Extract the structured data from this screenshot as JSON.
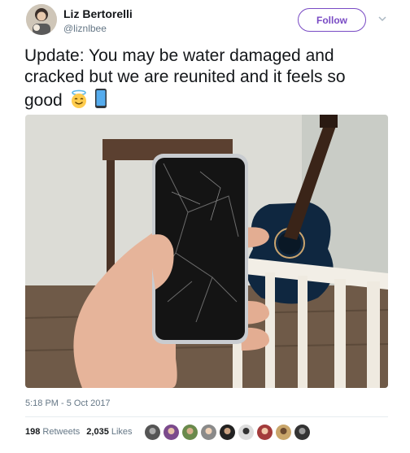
{
  "user": {
    "display_name": "Liz Bertorelli",
    "handle": "@liznlbee"
  },
  "follow_label": "Follow",
  "tweet": {
    "text": "Update: You may be water damaged and cracked but we are reunited and it feels so good"
  },
  "timestamp": "5:18 PM - 5 Oct 2017",
  "stats": {
    "retweets_count": "198",
    "retweets_label": "Retweets",
    "likes_count": "2,035",
    "likes_label": "Likes"
  },
  "colors": {
    "accent": "#794bc4",
    "secondary_text": "#657786"
  }
}
